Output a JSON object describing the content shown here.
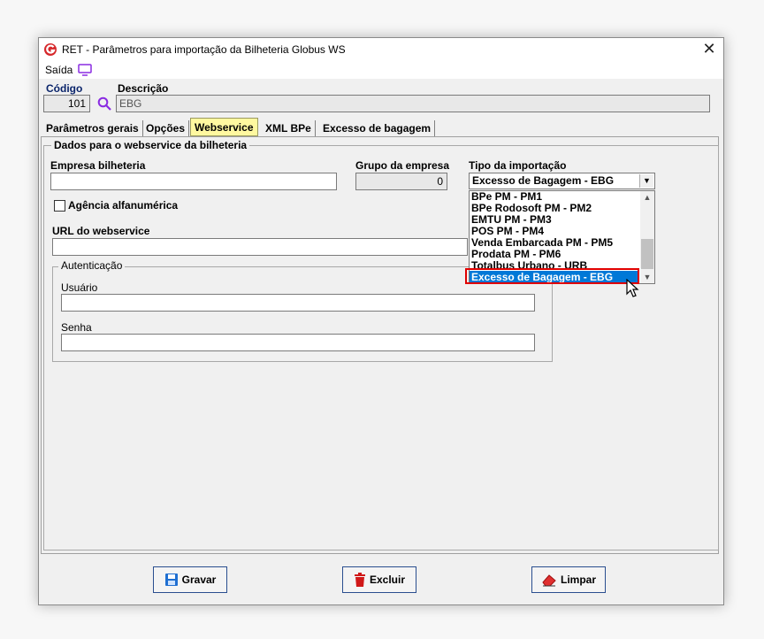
{
  "window": {
    "title": "RET - Parâmetros para importação da Bilheteria Globus WS"
  },
  "menu": {
    "exit_label": "Saída"
  },
  "header": {
    "code_label": "Código",
    "code_value": "101",
    "description_label": "Descrição",
    "description_value": "EBG"
  },
  "tabs": [
    {
      "label": "Parâmetros gerais"
    },
    {
      "label": "Opções"
    },
    {
      "label": "Webservice"
    },
    {
      "label": "XML BPe"
    },
    {
      "label": "Excesso de bagagem"
    }
  ],
  "webservice": {
    "group_title": "Dados para o webservice da bilheteria",
    "company_label": "Empresa bilheteria",
    "company_value": "",
    "company_group_label": "Grupo da empresa",
    "company_group_value": "0",
    "import_type_label": "Tipo da importação",
    "import_type_value": "Excesso de Bagagem - EBG",
    "alphanumeric_agency_label": "Agência alfanumérica",
    "alphanumeric_agency_checked": false,
    "url_label": "URL do webservice",
    "url_value": "",
    "auth_title": "Autenticação",
    "user_label": "Usuário",
    "user_value": "",
    "password_label": "Senha",
    "password_value": ""
  },
  "dropdown": {
    "options": [
      "BPe PM - PM1",
      "BPe Rodosoft PM - PM2",
      "EMTU PM - PM3",
      "POS PM - PM4",
      "Venda Embarcada PM - PM5",
      "Prodata PM - PM6",
      "Totalbus Urbano - URB",
      "Excesso de Bagagem - EBG"
    ],
    "selected_index": 7
  },
  "buttons": {
    "save_label": "Gravar",
    "delete_label": "Excluir",
    "clear_label": "Limpar"
  },
  "colors": {
    "highlight": "#0078d7",
    "red_outline": "#e00000",
    "active_tab": "#fff8a0",
    "label_blue": "#0a246a"
  }
}
